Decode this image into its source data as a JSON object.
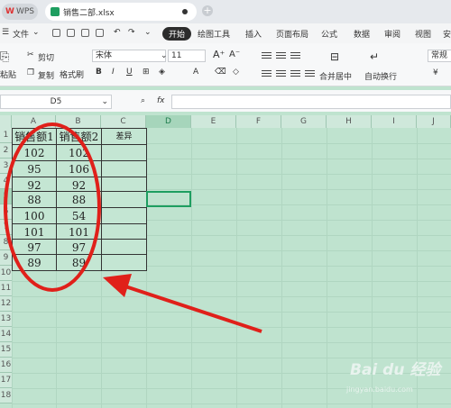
{
  "titlebar": {
    "app_tab": "WPS",
    "file_tab": "销售二部.xlsx"
  },
  "menubar": {
    "file_menu": "文件",
    "items": [
      "开始",
      "绘图工具",
      "插入",
      "页面布局",
      "公式",
      "数据",
      "审阅",
      "视图",
      "安"
    ]
  },
  "ribbon": {
    "cut": "剪切",
    "copy": "复制",
    "format_painter": "格式刷",
    "paste": "粘贴",
    "font_name": "宋体",
    "font_size": "11",
    "merge_center": "合并居中",
    "wrap_text": "自动换行",
    "number_format": "常规"
  },
  "formula_bar": {
    "name_box": "D5",
    "fx_label": "fx",
    "formula": ""
  },
  "columns": [
    "A",
    "B",
    "C",
    "D",
    "E",
    "F",
    "G",
    "H",
    "I",
    "J"
  ],
  "rows": [
    "1",
    "2",
    "3",
    "4",
    "5",
    "6",
    "7",
    "8",
    "9",
    "10",
    "11",
    "12",
    "13",
    "14",
    "15",
    "16",
    "17",
    "18"
  ],
  "table": {
    "headers": [
      "销售额1",
      "销售额2",
      "差异"
    ],
    "rows": [
      [
        "102",
        "102",
        ""
      ],
      [
        "95",
        "106",
        ""
      ],
      [
        "92",
        "92",
        ""
      ],
      [
        "88",
        "88",
        ""
      ],
      [
        "100",
        "54",
        ""
      ],
      [
        "101",
        "101",
        ""
      ],
      [
        "97",
        "97",
        ""
      ],
      [
        "89",
        "89",
        ""
      ]
    ]
  },
  "selected_cell": "D5",
  "annotation": {
    "color": "#e0201a"
  },
  "watermark": {
    "text": "Bai du 经验",
    "url": "jingyan.baidu.com"
  }
}
